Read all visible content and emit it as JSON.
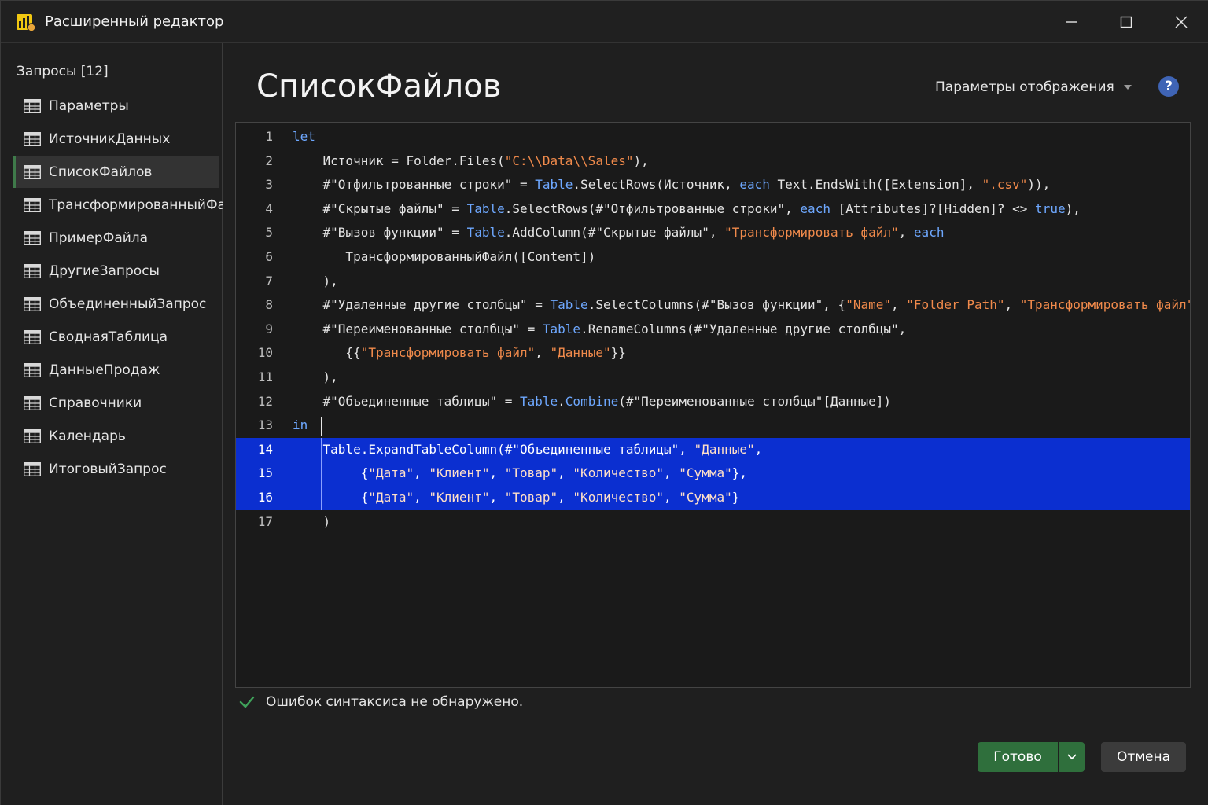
{
  "window": {
    "title": "Расширенный редактор"
  },
  "sidebar": {
    "header": "Запросы [12]",
    "items": [
      {
        "label": "Параметры"
      },
      {
        "label": "ИсточникДанных"
      },
      {
        "label": "СписокФайлов",
        "selected": true
      },
      {
        "label": "ТрансформированныйФайл"
      },
      {
        "label": "ПримерФайла"
      },
      {
        "label": "ДругиеЗапросы"
      },
      {
        "label": "ОбъединенныйЗапрос"
      },
      {
        "label": "СводнаяТаблица"
      },
      {
        "label": "ДанныеПродаж"
      },
      {
        "label": "Справочники"
      },
      {
        "label": "Календарь"
      },
      {
        "label": "ИтоговыйЗапрос"
      }
    ]
  },
  "main": {
    "query_title": "СписокФайлов",
    "display_options": "Параметры отображения",
    "help": "?"
  },
  "editor": {
    "highlighted_lines": [
      14,
      15,
      16
    ],
    "lines": [
      {
        "n": "1",
        "tokens": [
          [
            "kw",
            "let"
          ]
        ]
      },
      {
        "n": "2",
        "tokens": [
          [
            "t",
            "    Источник = Folder.Files("
          ],
          [
            "str",
            "\"C:\\\\Data\\\\Sales\""
          ],
          [
            "t",
            "),"
          ]
        ]
      },
      {
        "n": "3",
        "tokens": [
          [
            "t",
            "    #\"Отфильтрованные строки\" = "
          ],
          [
            "kw",
            "Table"
          ],
          [
            "t",
            ".SelectRows(Источник, "
          ],
          [
            "kw",
            "each"
          ],
          [
            "t",
            " Text.EndsWith([Extension], "
          ],
          [
            "str",
            "\".csv\""
          ],
          [
            "t",
            ")),"
          ]
        ]
      },
      {
        "n": "4",
        "tokens": [
          [
            "t",
            "    #\"Скрытые файлы\" = "
          ],
          [
            "kw",
            "Table"
          ],
          [
            "t",
            ".SelectRows(#\"Отфильтрованные строки\", "
          ],
          [
            "kw",
            "each"
          ],
          [
            "t",
            " [Attributes]?[Hidden]? <> "
          ],
          [
            "kw",
            "true"
          ],
          [
            "t",
            "),"
          ]
        ]
      },
      {
        "n": "5",
        "tokens": [
          [
            "t",
            "    #\"Вызов функции\" = "
          ],
          [
            "kw",
            "Table"
          ],
          [
            "t",
            ".AddColumn(#\"Скрытые файлы\", "
          ],
          [
            "str",
            "\"Трансформировать файл\""
          ],
          [
            "t",
            ", "
          ],
          [
            "kw",
            "each"
          ]
        ]
      },
      {
        "n": "6",
        "tokens": [
          [
            "t",
            "       ТрансформированныйФайл([Content])"
          ]
        ]
      },
      {
        "n": "7",
        "tokens": [
          [
            "t",
            "    ),"
          ]
        ]
      },
      {
        "n": "8",
        "tokens": [
          [
            "t",
            "    #\"Удаленные другие столбцы\" = "
          ],
          [
            "kw",
            "Table"
          ],
          [
            "t",
            ".SelectColumns(#\"Вызов функции\", {"
          ],
          [
            "str",
            "\"Name\""
          ],
          [
            "t",
            ", "
          ],
          [
            "str",
            "\"Folder Path\""
          ],
          [
            "t",
            ", "
          ],
          [
            "str",
            "\"Трансформировать файл\""
          ],
          [
            "t",
            "}),"
          ]
        ]
      },
      {
        "n": "9",
        "tokens": [
          [
            "t",
            "    #\"Переименованные столбцы\" = "
          ],
          [
            "kw",
            "Table"
          ],
          [
            "t",
            ".RenameColumns(#\"Удаленные другие столбцы\","
          ]
        ]
      },
      {
        "n": "10",
        "tokens": [
          [
            "t",
            "       {{"
          ],
          [
            "str",
            "\"Трансформировать файл\""
          ],
          [
            "t",
            ", "
          ],
          [
            "str",
            "\"Данные\""
          ],
          [
            "t",
            "}}"
          ]
        ]
      },
      {
        "n": "11",
        "tokens": [
          [
            "t",
            "    ),"
          ]
        ]
      },
      {
        "n": "12",
        "tokens": [
          [
            "t",
            "    #\"Объединенные таблицы\" = "
          ],
          [
            "kw",
            "Table"
          ],
          [
            "t",
            "."
          ],
          [
            "kw",
            "Combine"
          ],
          [
            "t",
            "(#\"Переименованные столбцы\"[Данные])"
          ]
        ]
      },
      {
        "n": "13",
        "tokens": [
          [
            "kw",
            "in"
          ]
        ]
      },
      {
        "n": "14",
        "tokens": [
          [
            "t",
            "    Table.ExpandTableColumn(#\"Объединенные таблицы\", "
          ],
          [
            "s2",
            "\"Данные\""
          ],
          [
            "t",
            ","
          ]
        ]
      },
      {
        "n": "15",
        "tokens": [
          [
            "t",
            "         {"
          ],
          [
            "s2",
            "\"Дата\""
          ],
          [
            "t",
            ", "
          ],
          [
            "s2",
            "\"Клиент\""
          ],
          [
            "t",
            ", "
          ],
          [
            "s2",
            "\"Товар\""
          ],
          [
            "t",
            ", "
          ],
          [
            "s2",
            "\"Количество\""
          ],
          [
            "t",
            ", "
          ],
          [
            "s2",
            "\"Сумма\""
          ],
          [
            "t",
            "},"
          ]
        ]
      },
      {
        "n": "16",
        "tokens": [
          [
            "t",
            "         {"
          ],
          [
            "s2",
            "\"Дата\""
          ],
          [
            "t",
            ", "
          ],
          [
            "s2",
            "\"Клиент\""
          ],
          [
            "t",
            ", "
          ],
          [
            "s2",
            "\"Товар\""
          ],
          [
            "t",
            ", "
          ],
          [
            "s2",
            "\"Количество\""
          ],
          [
            "t",
            ", "
          ],
          [
            "s2",
            "\"Сумма\""
          ],
          [
            "t",
            "}"
          ]
        ]
      },
      {
        "n": "17",
        "tokens": [
          [
            "t",
            "    )"
          ]
        ]
      }
    ]
  },
  "status": {
    "text": "Ошибок синтаксиса не обнаружено."
  },
  "buttons": {
    "done": "Готово",
    "cancel": "Отмена"
  },
  "colors": {
    "accent_green": "#2f6f3c",
    "selection_blue": "#0b2fd0",
    "keyword": "#6ea8ff",
    "string": "#f08a4b",
    "help_blue": "#3f64b5"
  }
}
